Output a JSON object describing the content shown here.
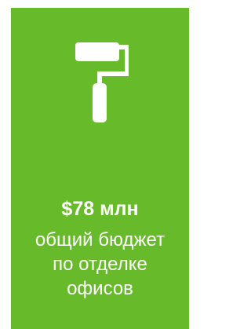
{
  "card": {
    "background": "#67bb2a",
    "icon": "paint-roller-icon",
    "amount": "$78 млн",
    "description_lines": [
      "общий бюджет",
      "по отделке",
      "офисов"
    ]
  }
}
